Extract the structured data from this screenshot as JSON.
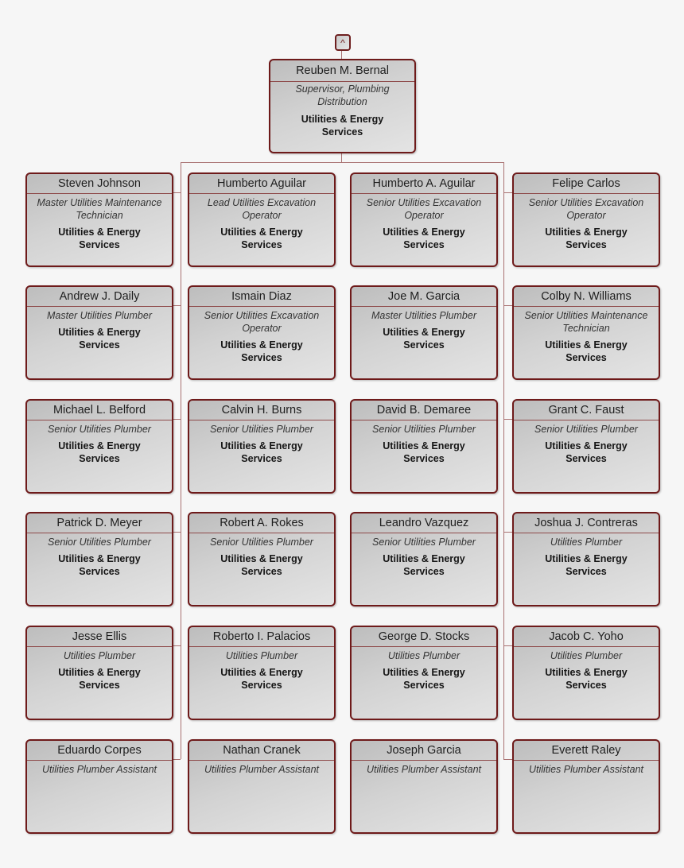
{
  "colors": {
    "card_border": "#6e1a1a",
    "connector": "#a97272",
    "background": "#f6f6f6"
  },
  "collapse_toggle": {
    "icon": "chevron-up-icon",
    "glyph": "^"
  },
  "root": {
    "name": "Reuben M. Bernal",
    "title": "Supervisor, Plumbing Distribution",
    "department": "Utilities & Energy Services"
  },
  "reports": [
    {
      "name": "Steven Johnson",
      "title": "Master Utilities Maintenance Technician",
      "department": "Utilities & Energy Services"
    },
    {
      "name": "Humberto Aguilar",
      "title": "Lead Utilities Excavation Operator",
      "department": "Utilities & Energy Services"
    },
    {
      "name": "Humberto A. Aguilar",
      "title": "Senior Utilities Excavation Operator",
      "department": "Utilities & Energy Services"
    },
    {
      "name": "Felipe Carlos",
      "title": "Senior Utilities Excavation Operator",
      "department": "Utilities & Energy Services"
    },
    {
      "name": "Andrew J. Daily",
      "title": "Master Utilities Plumber",
      "department": "Utilities & Energy Services"
    },
    {
      "name": "Ismain Diaz",
      "title": "Senior Utilities Excavation Operator",
      "department": "Utilities & Energy Services"
    },
    {
      "name": "Joe M. Garcia",
      "title": "Master Utilities Plumber",
      "department": "Utilities & Energy Services"
    },
    {
      "name": "Colby N. Williams",
      "title": "Senior Utilities Maintenance Technician",
      "department": "Utilities & Energy Services"
    },
    {
      "name": "Michael L. Belford",
      "title": "Senior Utilities Plumber",
      "department": "Utilities & Energy Services"
    },
    {
      "name": "Calvin H. Burns",
      "title": "Senior Utilities Plumber",
      "department": "Utilities & Energy Services"
    },
    {
      "name": "David B. Demaree",
      "title": "Senior Utilities Plumber",
      "department": "Utilities & Energy Services"
    },
    {
      "name": "Grant C. Faust",
      "title": "Senior Utilities Plumber",
      "department": "Utilities & Energy Services"
    },
    {
      "name": "Patrick D. Meyer",
      "title": "Senior Utilities Plumber",
      "department": "Utilities & Energy Services"
    },
    {
      "name": "Robert A. Rokes",
      "title": "Senior Utilities Plumber",
      "department": "Utilities & Energy Services"
    },
    {
      "name": "Leandro Vazquez",
      "title": "Senior Utilities Plumber",
      "department": "Utilities & Energy Services"
    },
    {
      "name": "Joshua J. Contreras",
      "title": "Utilities Plumber",
      "department": "Utilities & Energy Services"
    },
    {
      "name": "Jesse Ellis",
      "title": "Utilities Plumber",
      "department": "Utilities & Energy Services"
    },
    {
      "name": "Roberto I. Palacios",
      "title": "Utilities Plumber",
      "department": "Utilities & Energy Services"
    },
    {
      "name": "George D. Stocks",
      "title": "Utilities Plumber",
      "department": "Utilities & Energy Services"
    },
    {
      "name": "Jacob C. Yoho",
      "title": "Utilities Plumber",
      "department": "Utilities & Energy Services"
    },
    {
      "name": "Eduardo Corpes",
      "title": "Utilities Plumber Assistant",
      "department": ""
    },
    {
      "name": "Nathan Cranek",
      "title": "Utilities Plumber Assistant",
      "department": ""
    },
    {
      "name": "Joseph Garcia",
      "title": "Utilities Plumber Assistant",
      "department": ""
    },
    {
      "name": "Everett Raley",
      "title": "Utilities Plumber Assistant",
      "department": ""
    }
  ]
}
